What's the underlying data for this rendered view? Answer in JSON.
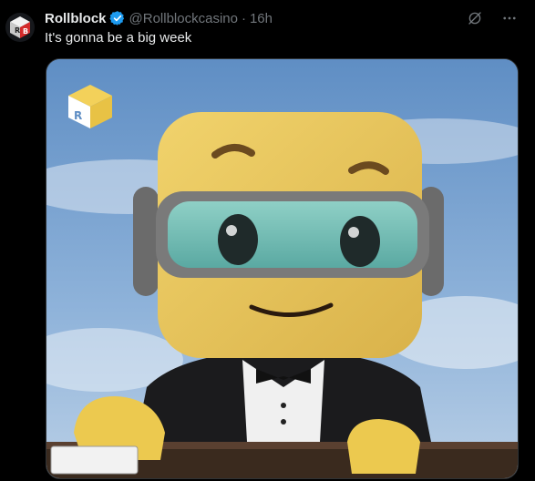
{
  "tweet": {
    "author_name": "Rollblock",
    "handle": "@Rollblockcasino",
    "separator": "·",
    "time": "16h",
    "text": "It's gonna be a big week",
    "verified": true,
    "accent_color": "#1d9bf0"
  },
  "media": {
    "description": "3D yellow block mascot with goggles wearing a tuxedo, hand on a deck of cards",
    "logo_icon": "rollblock-cube-logo-icon"
  },
  "actions": {
    "grok_icon": "grok-icon",
    "more_icon": "more-options-icon"
  }
}
